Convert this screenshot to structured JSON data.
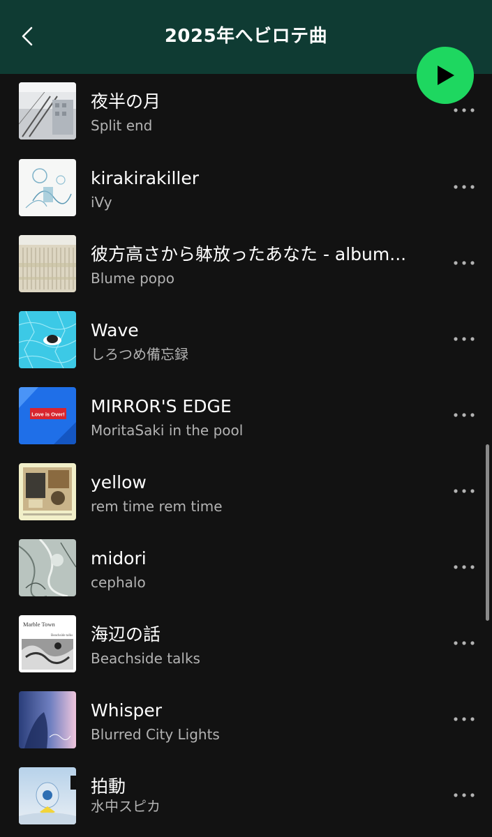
{
  "header": {
    "title": "2025年へビロテ曲",
    "back_icon": "chevron-left-icon",
    "play_icon": "play-icon",
    "accent_color": "#1ed760",
    "background_color": "#0f3b33"
  },
  "tracks": [
    {
      "title": "夜半の月",
      "artist": "Split end"
    },
    {
      "title": "kirakirakiller",
      "artist": "iVy"
    },
    {
      "title": "彼方高さから躰放ったあなた - album...",
      "artist": "Blume popo"
    },
    {
      "title": "Wave",
      "artist": "しろつめ備忘録"
    },
    {
      "title": "MIRROR'S EDGE",
      "artist": "MoritaSaki in the pool"
    },
    {
      "title": "yellow",
      "artist": "rem time rem time"
    },
    {
      "title": "midori",
      "artist": "cephalo"
    },
    {
      "title": "海辺の話",
      "artist": "Beachside talks"
    },
    {
      "title": "Whisper",
      "artist": "Blurred City Lights"
    },
    {
      "title": "拍動",
      "artist": "水中スピカ"
    }
  ],
  "album_art_text": {
    "mirrors_edge": "Love is Over!",
    "beachside_top": "Marble Town",
    "beachside_sub": "Beachside talks"
  },
  "more_icon": "more-horizontal-icon"
}
